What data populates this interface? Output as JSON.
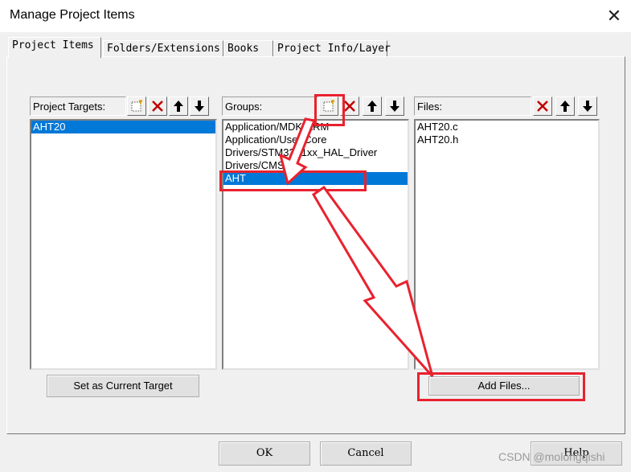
{
  "window": {
    "title": "Manage Project Items"
  },
  "tabs": [
    {
      "label": "Project Items",
      "active": true
    },
    {
      "label": "Folders/Extensions"
    },
    {
      "label": "Books"
    },
    {
      "label": "Project Info/Layer"
    }
  ],
  "targets": {
    "label": "Project Targets:",
    "items": [
      {
        "text": "AHT20",
        "selected": true
      }
    ]
  },
  "groups": {
    "label": "Groups:",
    "items": [
      {
        "text": "Application/MDK-ARM"
      },
      {
        "text": "Application/User/Core"
      },
      {
        "text": "Drivers/STM32F1xx_HAL_Driver"
      },
      {
        "text": "Drivers/CMSIS"
      },
      {
        "text": "AHT",
        "selected": true
      }
    ]
  },
  "files": {
    "label": "Files:",
    "items": [
      {
        "text": "AHT20.c"
      },
      {
        "text": "AHT20.h"
      }
    ]
  },
  "buttons": {
    "set_current_target": "Set as Current Target",
    "add_files": "Add Files...",
    "ok": "OK",
    "cancel": "Cancel",
    "help": "Help"
  },
  "watermark": "CSDN @molongqishi",
  "colors": {
    "accent": "#0078d7",
    "annotation": "#e8222e",
    "delete": "#c00000"
  },
  "icons": {
    "new": "new-item-icon",
    "delete": "delete-x-icon",
    "up": "move-up-arrow-icon",
    "down": "move-down-arrow-icon"
  }
}
